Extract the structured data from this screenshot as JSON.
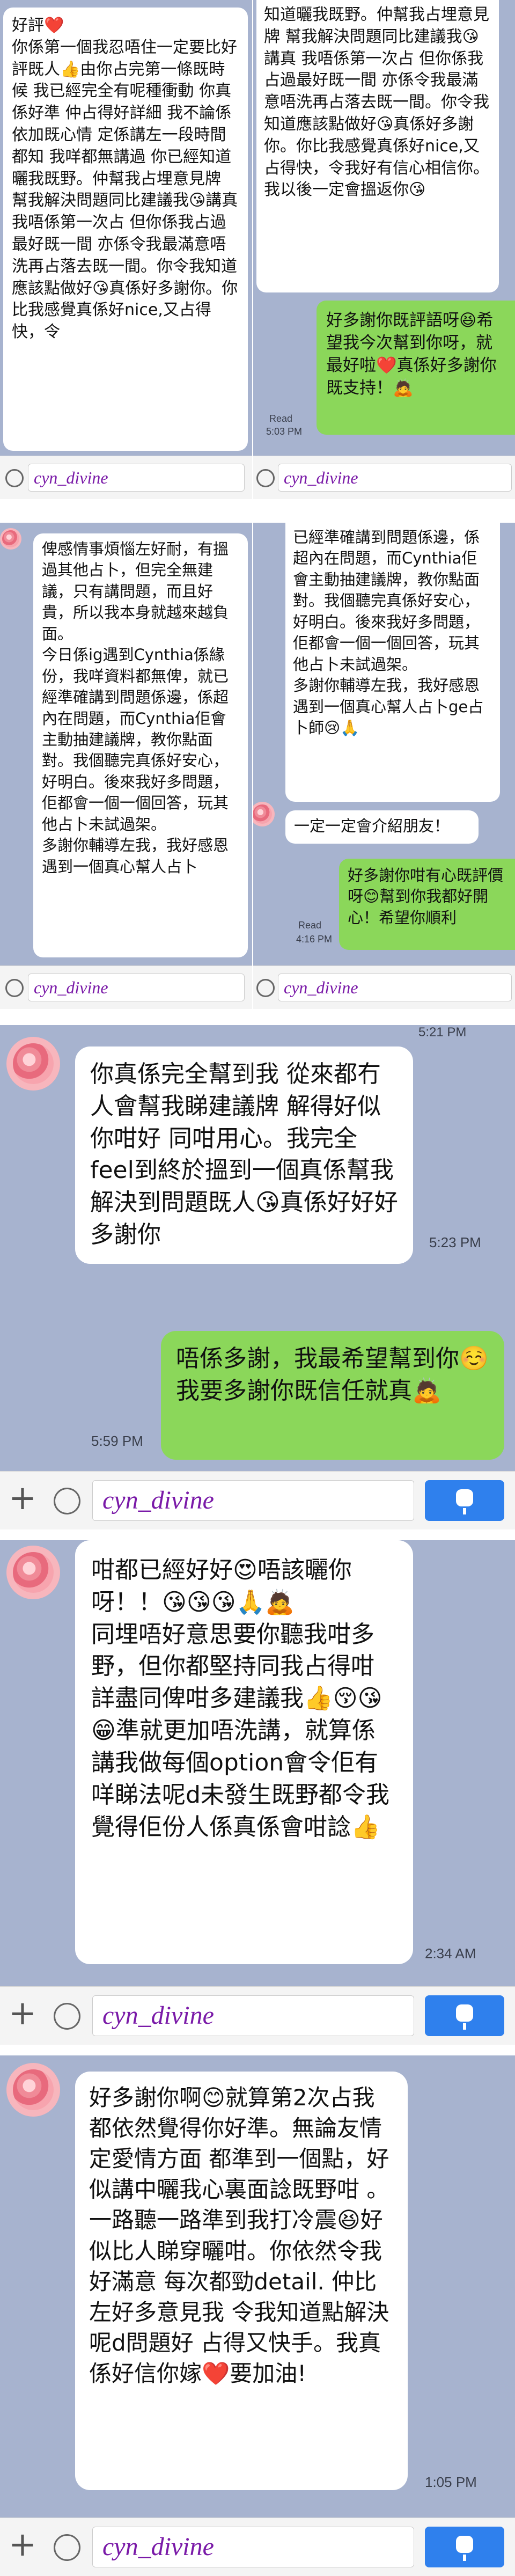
{
  "app": {
    "accent": "#2f80ed",
    "green_bubble": "#8bd75a",
    "bg": "#a7b3cf"
  },
  "panel1": {
    "left_text": "好評❤️\n你係第一個我忍唔住一定要比好評既人👍由你占完第一條既時候 我已經完全有呢種衝動 你真係好準 仲占得好詳細 我不論係依加既心情 定係講左一段時間都知 我咩都無講過 你已經知道曬我既野。仲幫我占埋意見牌 幫我解決問題同比建議我😘講真 我唔係第一次占 但你係我占過最好既一間 亦係令我最滿意唔洗再占落去既一間。你令我知道應該點做好😘真係好多謝你。你比我感覺真係好nice,又占得快，令",
    "right_text": "知道曬我既野。仲幫我占埋意見牌 幫我解決問題同比建議我😘講真 我唔係第一次占 但你係我占過最好既一間 亦係令我最滿意唔洗再占落去既一間。你令我知道應該點做好😘真係好多謝你。你比我感覺真係好nice,又占得快，令我好有信心相信你。我以後一定會搵返你😘",
    "reply": "好多謝你既評語呀😆希望我今次幫到你呀，就最好啦❤️真係好多謝你既支持！🙇",
    "read": "Read",
    "time": "5:03 PM",
    "input_left": "cyn_divine",
    "input_right": "cyn_divine"
  },
  "panel2": {
    "left_text": "俾感情事煩惱左好耐，有搵過其他占卜，但完全無建議，只有講問題，而且好貴，所以我本身就越來越負面。\n今日係ig遇到Cynthia係緣份，我咩資料都無俾，就已經準確講到問題係邊，係超內在問題，而Cynthia佢會主動抽建議牌，教你點面對。我個聽完真係好安心，好明白。後來我好多問題，佢都會一個一個回答，玩其他占卜未試過架。\n多謝你輔導左我，我好感恩遇到一個真心幫人占卜",
    "right_text": "已經準確講到問題係邊，係超內在問題，而Cynthia佢會主動抽建議牌，教你點面對。我個聽完真係好安心，好明白。後來我好多問題，佢都會一個一個回答，玩其他占卜未試過架。\n多謝你輔導左我，我好感恩遇到一個真心幫人占卜ge占卜師😢🙏",
    "right_reply1": "一定一定會介紹朋友！",
    "right_reply2": "好多謝你咁有心既評價呀😊幫到你我都好開心！希望你順利",
    "read": "Read",
    "time": "4:16 PM",
    "input_left": "cyn_divine",
    "input_right": "cyn_divine"
  },
  "panel3": {
    "top_time": "5:21 PM",
    "msg": "你真係完全幫到我 從來都冇人會幫我睇建議牌 解得好似你咁好 同咁用心。我完全feel到終於搵到一個真係幫我解決到問題既人😘真係好好好多謝你",
    "msg_time": "5:23 PM",
    "reply": "唔係多謝，我最希望幫到你☺️ 我要多謝你既信任就真🙇",
    "reply_time": "5:59 PM",
    "input": "cyn_divine"
  },
  "panel4": {
    "msg": "咁都已經好好😍唔該曬你呀！！😘😘😘🙏🙇\n同埋唔好意思要你聽我咁多野，但你都堅持同我占得咁詳盡同俾咁多建議我👍😚😘😁準就更加唔洗講，就算係講我做每個option會令佢有咩睇法呢d未發生既野都令我覺得佢份人係真係會咁諗👍",
    "time": "2:34 AM",
    "input": "cyn_divine"
  },
  "panel5": {
    "msg": "好多謝你啊😊就算第2次占我都依然覺得你好準。無論友情定愛情方面 都準到一個點，好似講中曬我心裏面諗既野咁 。一路聽一路準到我打冷震😆好似比人睇穿曬咁。你依然令我好滿意 每次都勁detail. 仲比左好多意見我 令我知道點解決呢d問題好 占得又快手。我真係好信你嫁❤️要加油!",
    "time": "1:05 PM",
    "input": "cyn_divine"
  }
}
